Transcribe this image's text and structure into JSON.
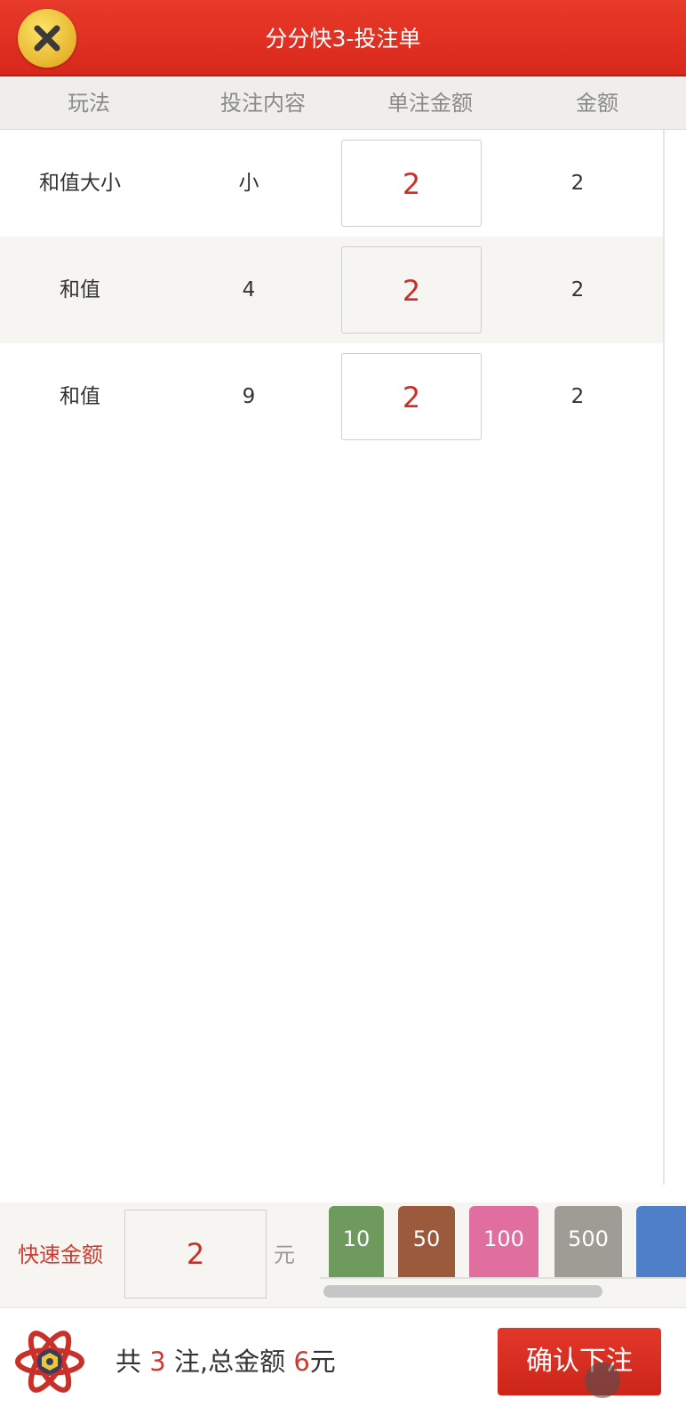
{
  "header": {
    "title": "分分快3-投注单",
    "close_icon": "close-icon"
  },
  "table": {
    "columns": [
      "玩法",
      "投注内容",
      "单注金额",
      "金额"
    ],
    "rows": [
      {
        "play": "和值大小",
        "content": "小",
        "unit_amount": "2",
        "amount": "2"
      },
      {
        "play": "和值",
        "content": "4",
        "unit_amount": "2",
        "amount": "2"
      },
      {
        "play": "和值",
        "content": "9",
        "unit_amount": "2",
        "amount": "2"
      }
    ]
  },
  "quick": {
    "label": "快速金额",
    "value": "2",
    "unit": "元",
    "chips": [
      {
        "label": "10",
        "color": "#6f9a5e"
      },
      {
        "label": "50",
        "color": "#9c5a3c"
      },
      {
        "label": "100",
        "color": "#e06fa0"
      },
      {
        "label": "500",
        "color": "#9f9c95"
      },
      {
        "label": "",
        "color": "#4f7fc8"
      }
    ]
  },
  "footer": {
    "prefix": "共",
    "bets": "3",
    "middle": "注,总金额",
    "total": "6",
    "suffix": "元",
    "confirm_label": "确认下注",
    "logo_icon": "atom-logo-icon"
  },
  "colors": {
    "header_red": "#d8281c",
    "accent_red": "#d33a2f",
    "close_yellow": "#e8b52c"
  }
}
